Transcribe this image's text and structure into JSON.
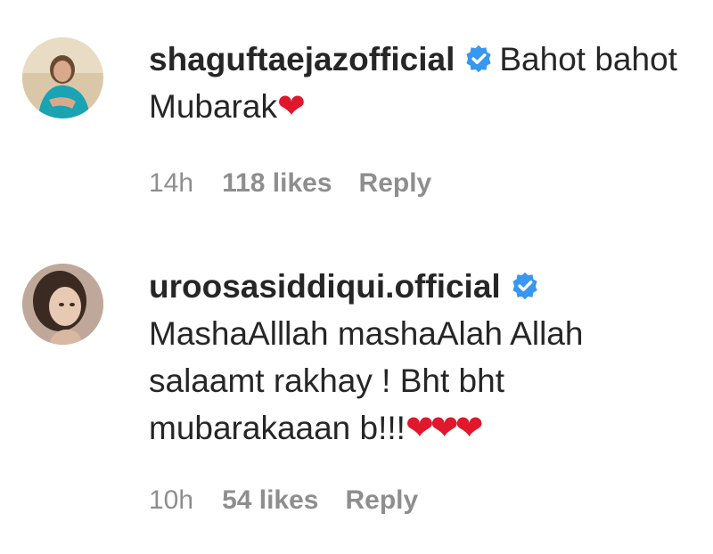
{
  "comments": [
    {
      "username": "shaguftaejazofficial",
      "verified": true,
      "text": "Bahot bahot Mubarak",
      "hearts": "❤",
      "time": "14h",
      "likes": "118 likes",
      "reply_label": "Reply",
      "avatar_icon": "profile-photo"
    },
    {
      "username": "uroosasiddiqui.official",
      "verified": true,
      "text": "MashaAlllah mashaAlah Allah salaamt rakhay ! Bht bht mubarakaaan b!!!",
      "hearts": "❤❤❤",
      "time": "10h",
      "likes": "54 likes",
      "reply_label": "Reply",
      "avatar_icon": "profile-photo"
    }
  ],
  "colors": {
    "text": "#262626",
    "secondary": "#8e8e8e",
    "verified_badge": "#3897f0",
    "heart": "#e0182d"
  }
}
